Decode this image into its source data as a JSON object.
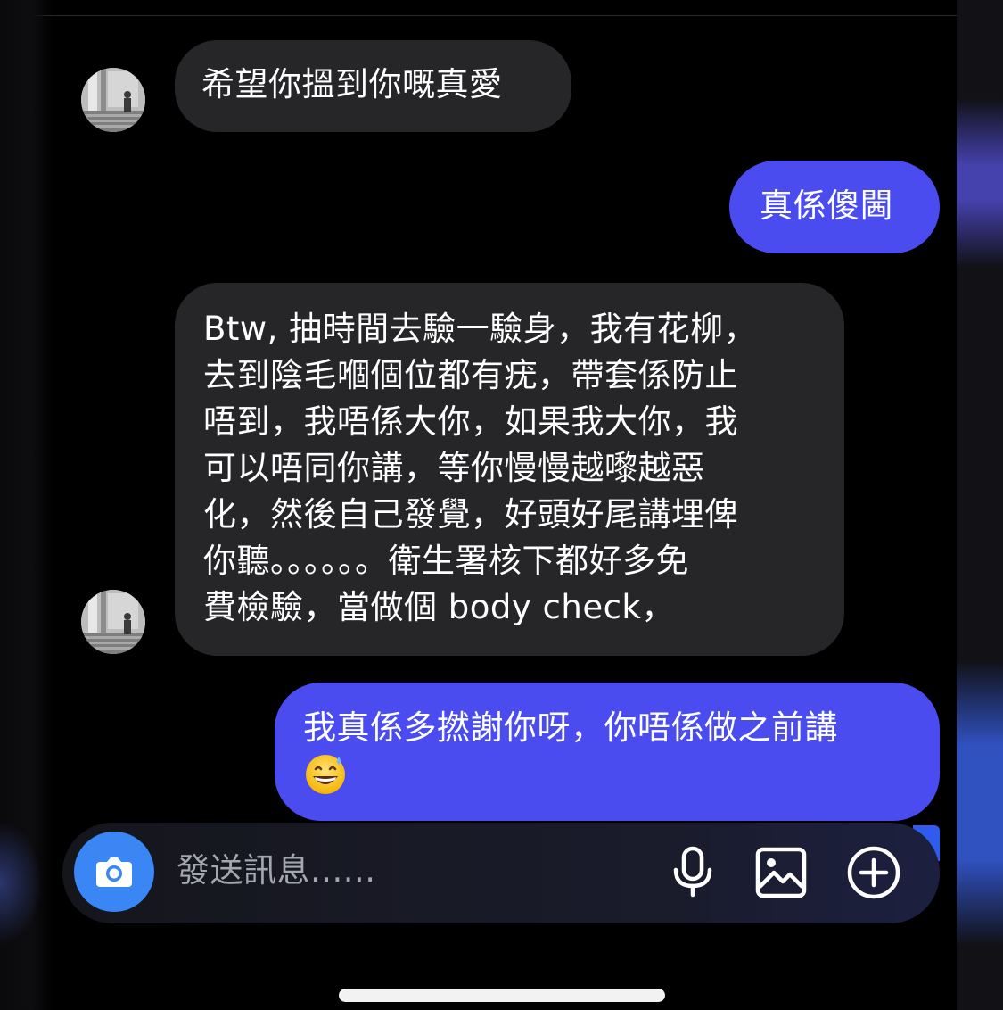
{
  "messages": [
    {
      "sender": "them",
      "text": "希望你搵到你嘅真愛"
    },
    {
      "sender": "me",
      "text": "真係傻閪"
    },
    {
      "sender": "them",
      "text": "Btw, 抽時間去驗一驗身，我有花柳，\n去到陰毛嗰個位都有疣，帶套係防止\n唔到，我唔係大你，如果我大你，我\n可以唔同你講，等你慢慢越嚟越惡\n化，然後自己發覺，好頭好尾講埋俾\n你聽。。。。。。衛生署核下都好多免\n費檢驗，當做個 body check，"
    },
    {
      "sender": "me",
      "text": "我真係多撚謝你呀，你唔係做之前講",
      "emoji": "grinning-face-with-sweat-emoji"
    }
  ],
  "composer": {
    "placeholder": "發送訊息......",
    "icons": [
      "camera-icon",
      "microphone-icon",
      "gallery-icon",
      "add-circle-icon"
    ]
  },
  "colors": {
    "background": "#000000",
    "incoming_bubble": "#262628",
    "outgoing_bubble": "#4a4cf0",
    "outgoing_bubble_latest": "#3e58f0",
    "camera_button": "#3a86f5",
    "placeholder_text": "#a4a6b0"
  }
}
